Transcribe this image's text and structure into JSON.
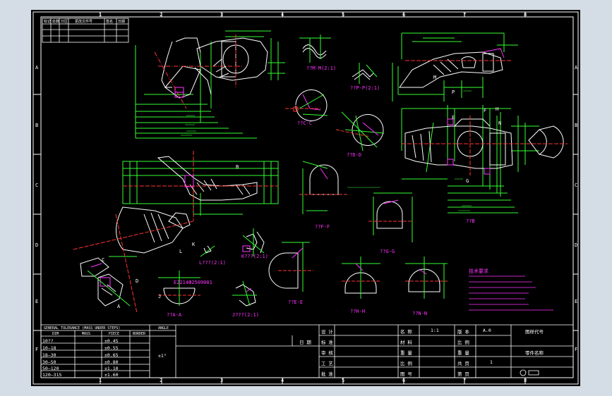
{
  "colors": {
    "background": "#000000",
    "frame": "#ffffff",
    "dimension": "#33ff33",
    "centerline": "#ff3333",
    "annotation": "#ff33ff",
    "outline": "#ffffff",
    "section": "#ffff33",
    "app_backdrop": "#d4dde6"
  },
  "zones": {
    "top": [
      "1",
      "2",
      "3",
      "4",
      "5",
      "6",
      "7",
      "8"
    ],
    "bottom": [
      "1",
      "2",
      "3",
      "4",
      "5",
      "6",
      "7",
      "8"
    ],
    "left": [
      "A",
      "B",
      "C",
      "D",
      "E",
      "F"
    ],
    "right": [
      "A",
      "B",
      "C",
      "D",
      "E",
      "F"
    ]
  },
  "views": {
    "m_detail": "??M-M(2:1)",
    "p_detail": "??P-P(2:1)",
    "c_section": "??C-C",
    "d_section": "??D-D",
    "f_section": "??F-F",
    "g_section": "??G-G",
    "b_view": "??B",
    "l_detail": "L???(2:1)",
    "k_detail": "K???(2:1)",
    "a_view": "??A-A",
    "j_detail": "J???(2:1)",
    "e_section": "??E-E",
    "h_section": "??H-H",
    "n_section": "??N-N"
  },
  "callouts": {
    "section_letters": [
      "C",
      "D",
      "A",
      "E",
      "F",
      "G",
      "H",
      "N",
      "B",
      "K",
      "P",
      "M",
      "L",
      "J"
    ],
    "spec": "E2214Ф2509001"
  },
  "notes_title": "技术要求",
  "tolerance_table": {
    "header": "GENERAL TOLERANCE  (MASS UNDER STEPS)",
    "col_headers": [
      "DIM",
      "MASS",
      "PIECE",
      "BORDER"
    ],
    "angle_label": "ANGLE",
    "angle_value": "±1°",
    "rows": [
      {
        "range": "10??",
        "tol": "±0.45"
      },
      {
        "range": "10–18",
        "tol": "±0.55"
      },
      {
        "range": "18–30",
        "tol": "±0.65"
      },
      {
        "range": "30–50",
        "tol": "±0.80"
      },
      {
        "range": "50–120",
        "tol": "±1.10"
      },
      {
        "range": "120–315",
        "tol": "±1.60"
      }
    ]
  },
  "revision_header": [
    "标记",
    "处数",
    "分区",
    "更改文件号",
    "签名",
    "日期"
  ],
  "title_block": {
    "sign_rows": [
      "设 计",
      "标 准",
      "审 核",
      "工 艺",
      "批 准"
    ],
    "date_label": "日 期",
    "mid_labels": [
      "名 称",
      "材 料",
      "重 量",
      "比 例",
      "图 号"
    ],
    "mid_values": [
      "1:1",
      "",
      "",
      "",
      ""
    ],
    "right_labels": [
      "版 本",
      "比 例",
      "重 量",
      "共 页",
      "第 页"
    ],
    "right_values": [
      "A.0",
      "",
      "",
      "1",
      ""
    ],
    "company_label": "图样代号",
    "part_label": "零件名称"
  }
}
